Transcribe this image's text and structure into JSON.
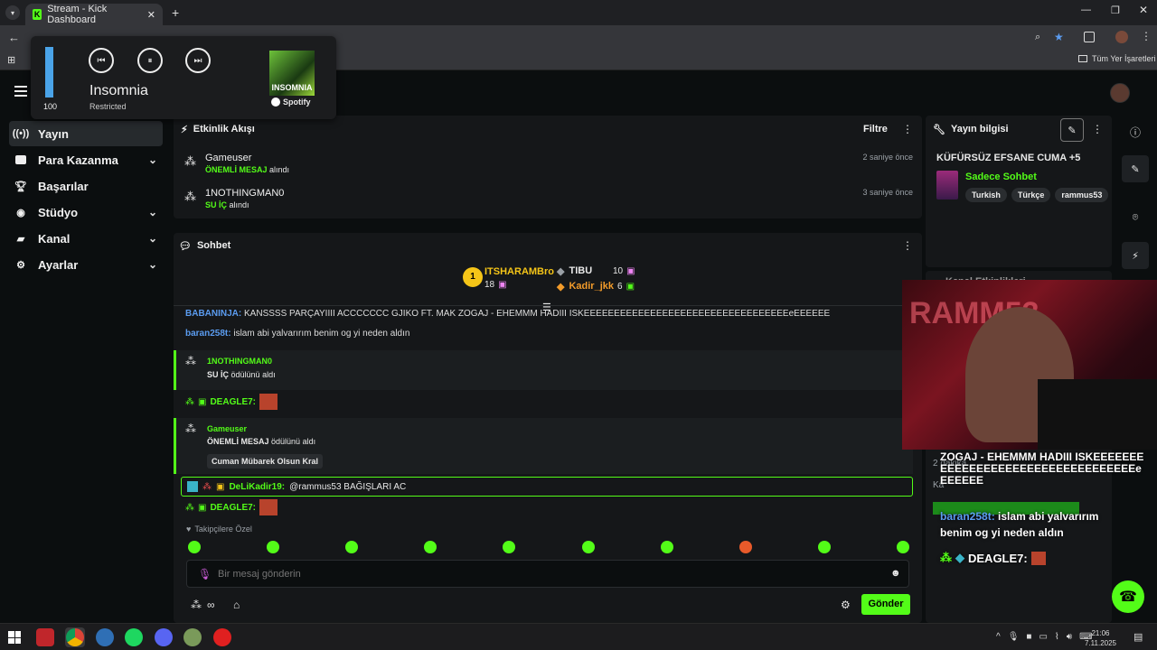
{
  "browser": {
    "tab_title": "Stream - Kick Dashboard",
    "bookmarks_label": "Tüm Yer İşaretleri"
  },
  "media": {
    "volume": "100",
    "volume_level": 1.0,
    "track": "Insomnia",
    "status": "Restricted",
    "album_art_text": "INSOMNIA",
    "source": "Spotify"
  },
  "sidebar": {
    "items": [
      {
        "label": "Yayın",
        "icon": "broadcast-icon"
      },
      {
        "label": "Para Kazanma",
        "icon": "wallet-icon"
      },
      {
        "label": "Başarılar",
        "icon": "trophy-icon"
      },
      {
        "label": "Stüdyo",
        "icon": "studio-icon"
      },
      {
        "label": "Kanal",
        "icon": "channel-icon"
      },
      {
        "label": "Ayarlar",
        "icon": "gear-icon"
      }
    ]
  },
  "activity": {
    "title": "Etkinlik Akışı",
    "filter": "Filtre",
    "events": [
      {
        "user": "Gameuser",
        "reward": "ÖNEMLİ MESAJ",
        "action": "alındı",
        "time": "2 saniye önce"
      },
      {
        "user": "1NOTHINGMAN0",
        "reward": "SU İÇ",
        "action": "alındı",
        "time": "3 saniye önce"
      }
    ]
  },
  "stream_info": {
    "title": "Yayın bilgisi",
    "stream_title": "KÜFÜRSÜZ EFSANE CUMA +5",
    "category": "Sadece Sohbet",
    "tags": [
      "Turkish",
      "Türkçe",
      "rammus53"
    ]
  },
  "chat": {
    "title": "Sohbet",
    "leaderboard": [
      {
        "name": "ITSHARAMBro",
        "count": "18"
      },
      {
        "name": "TIBU",
        "count": "10"
      },
      {
        "name": "Kadir_jkk",
        "count": "6"
      }
    ],
    "line1_user": "BABANINJA:",
    "line1_text": "KANSSSS PARÇAYIIII ACCCCCCC GJIKO FT. MAK ZOGAJ - EHEMMM HADIII ISKEEEEEEEEEEEEEEEEEEEEEEEEEEEEEEEEEEeEEEEEE",
    "line2_user": "baran258t:",
    "line2_text": "islam abi yalvarırım benim og yi neden aldın",
    "redeem1_user": "1NOTHINGMAN0",
    "redeem1_reward": "SU İÇ",
    "redeem1_action": "ödülünü aldı",
    "deagle_user": "DEAGLE7:",
    "redeem2_user": "Gameuser",
    "redeem2_reward": "ÖNEMLİ MESAJ",
    "redeem2_action": "ödülünü aldı",
    "redeem2_message": "Cuman Mübarek Olsun Kral",
    "highlight_user": "DeLiKadir19:",
    "highlight_text": "@rammus53 BAĞIŞLARI AC",
    "deagle2_user": "DEAGLE7:",
    "followers_only": "Takipçilere Özel",
    "input_placeholder": "Bir mesaj gönderin",
    "send": "Gönder"
  },
  "overlay": {
    "kanal_partial": "Kanal Etkinlikleri",
    "line1": "ZOGAJ - EHEMMM HADIII ISKEEEEEEEEEEEEEEEEEEEEEEEEEEEEEEEEEEeEEEEEE",
    "line2_user": "baran258t:",
    "line2_text": "islam abi yalvarırım benim og yi neden aldın",
    "line3_user": "DEAGLE7:",
    "bg_partial_1": "2 dakika",
    "bg_partial_2": "Ka"
  },
  "taskbar": {
    "time": "21:06",
    "date": "7.11.2025"
  },
  "colors": {
    "accent": "#53fc18",
    "bg": "#0b0e0f",
    "panel": "#151719"
  }
}
